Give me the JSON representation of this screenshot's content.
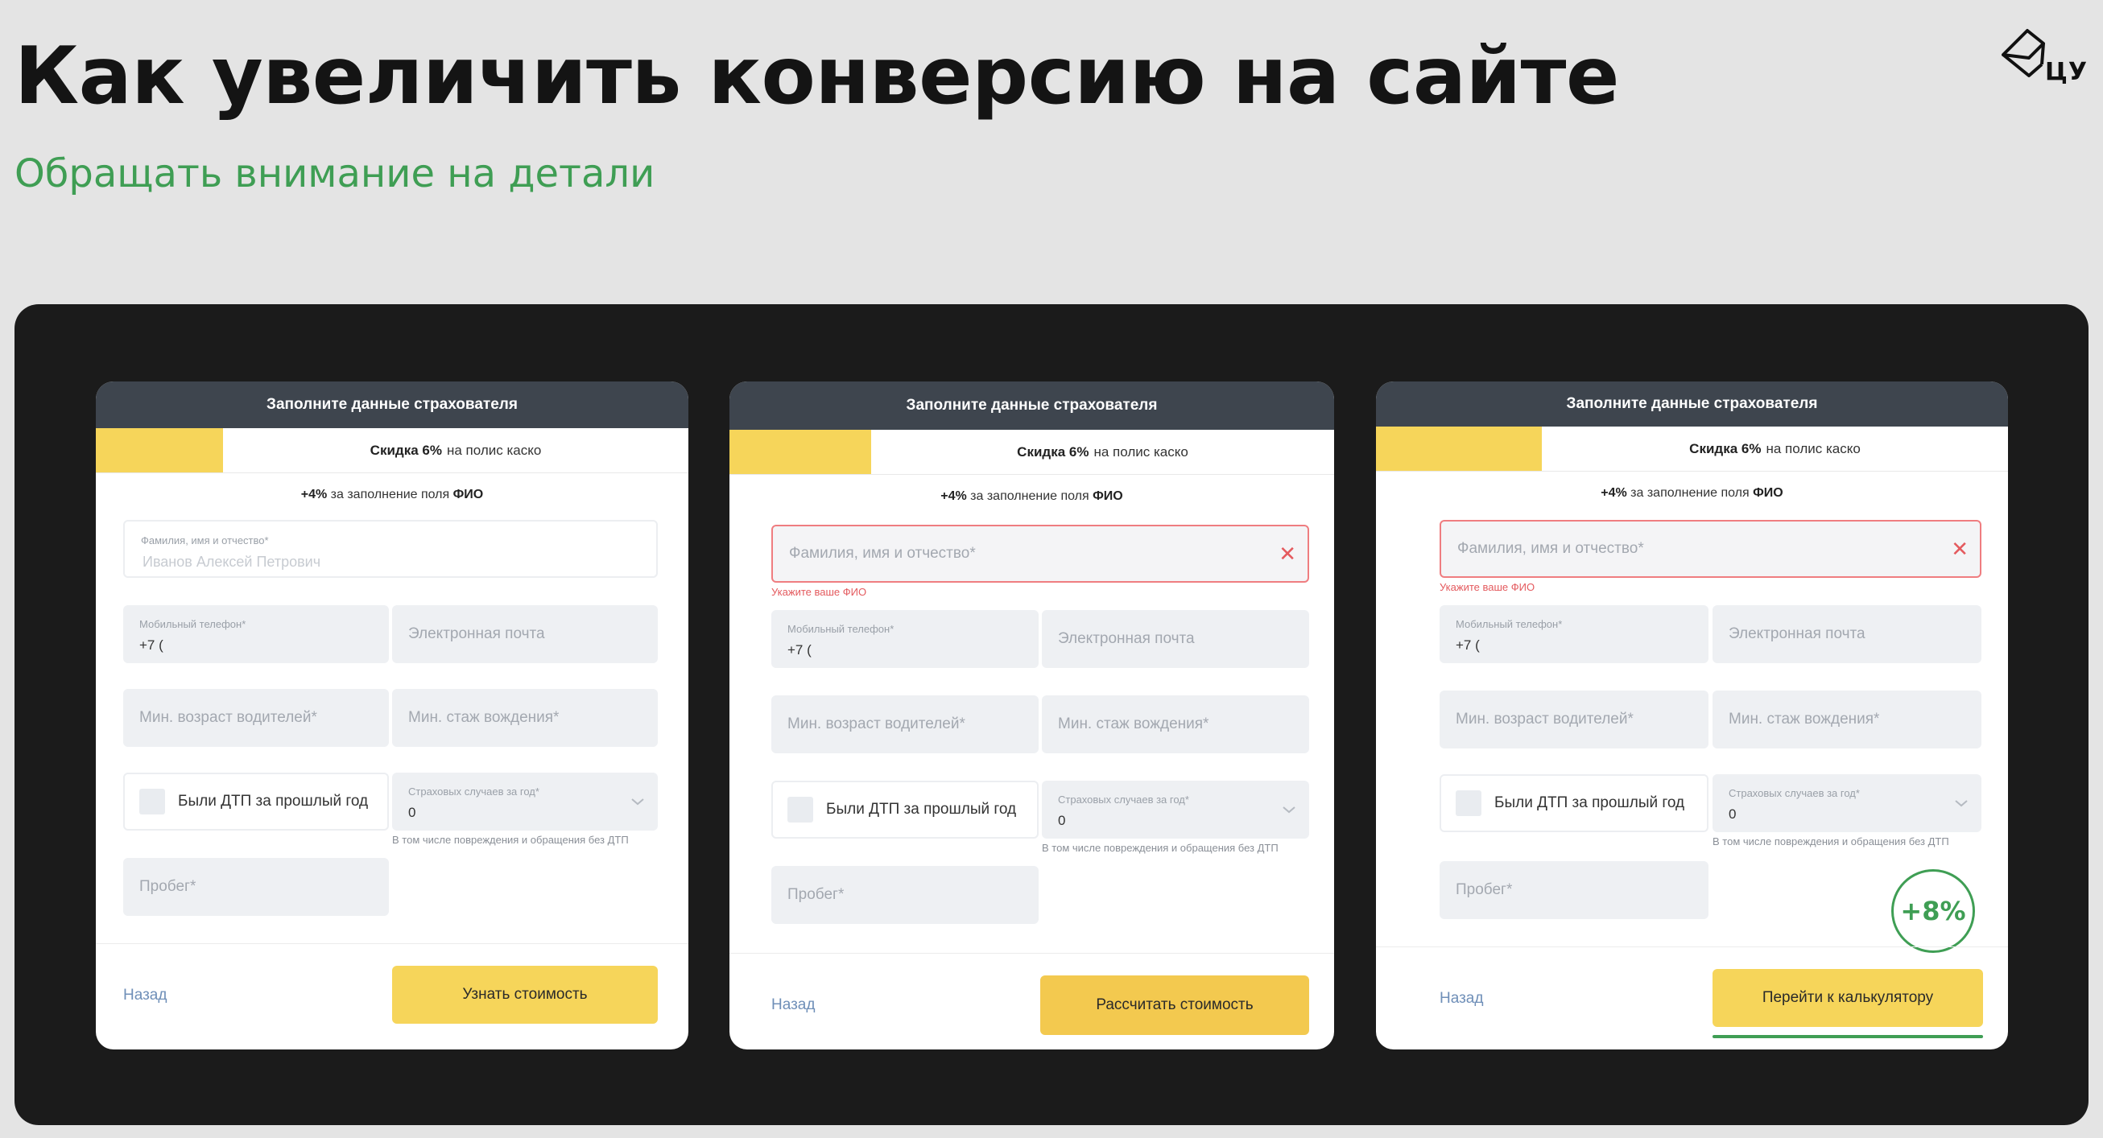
{
  "slide": {
    "title": "Как увеличить конверсию на сайте",
    "subtitle": "Обращать внимание на детали",
    "logo_text": "ЦУ"
  },
  "colors": {
    "accent_green": "#3f9e54",
    "cta_yellow": "#f6d55a",
    "header_dark": "#3e454e",
    "error_red": "#ef7d80"
  },
  "cards": [
    {
      "header": "Заполните данные страхователя",
      "discount_bold": "Скидка 6%",
      "discount_rest": "на полис каско",
      "hint_pre": "+4%",
      "hint_mid": "за заполнение поля",
      "hint_bold": "ФИО",
      "fio_label": "Фамилия, имя и отчество*",
      "fio_placeholder": "Иванов Алексей Петрович",
      "phone_label": "Мобильный телефон*",
      "phone_value": "+7 (",
      "email": "Электронная почта",
      "min_age": "Мин. возраст водителей*",
      "min_exp": "Мин. стаж вождения*",
      "dtp": "Были ДТП за прошлый год",
      "claims_label": "Страховых случаев за год*",
      "claims_value": "0",
      "claims_note": "В том числе повреждения и обращения без ДТП",
      "mileage": "Пробег*",
      "back": "Назад",
      "cta": "Узнать стоимость"
    },
    {
      "header": "Заполните данные страхователя",
      "discount_bold": "Скидка 6%",
      "discount_rest": "на полис каско",
      "hint_pre": "+4%",
      "hint_mid": "за заполнение поля",
      "hint_bold": "ФИО",
      "fio_label": "Фамилия, имя и отчество*",
      "fio_error": "Укажите ваше ФИО",
      "phone_label": "Мобильный телефон*",
      "phone_value": "+7 (",
      "email": "Электронная почта",
      "min_age": "Мин. возраст водителей*",
      "min_exp": "Мин. стаж вождения*",
      "dtp": "Были ДТП за прошлый год",
      "claims_label": "Страховых случаев за год*",
      "claims_value": "0",
      "claims_note": "В том числе повреждения и обращения без ДТП",
      "mileage": "Пробег*",
      "back": "Назад",
      "cta": "Рассчитать стоимость"
    },
    {
      "header": "Заполните данные страхователя",
      "discount_bold": "Скидка 6%",
      "discount_rest": "на полис каско",
      "hint_pre": "+4%",
      "hint_mid": "за заполнение поля",
      "hint_bold": "ФИО",
      "fio_label": "Фамилия, имя и отчество*",
      "fio_error": "Укажите ваше ФИО",
      "phone_label": "Мобильный телефон*",
      "phone_value": "+7 (",
      "email": "Электронная почта",
      "min_age": "Мин. возраст водителей*",
      "min_exp": "Мин. стаж вождения*",
      "dtp": "Были ДТП за прошлый год",
      "claims_label": "Страховых случаев за год*",
      "claims_value": "0",
      "claims_note": "В том числе повреждения и обращения без ДТП",
      "mileage": "Пробег*",
      "back": "Назад",
      "cta": "Перейти к калькулятору",
      "badge": "+8%"
    }
  ]
}
